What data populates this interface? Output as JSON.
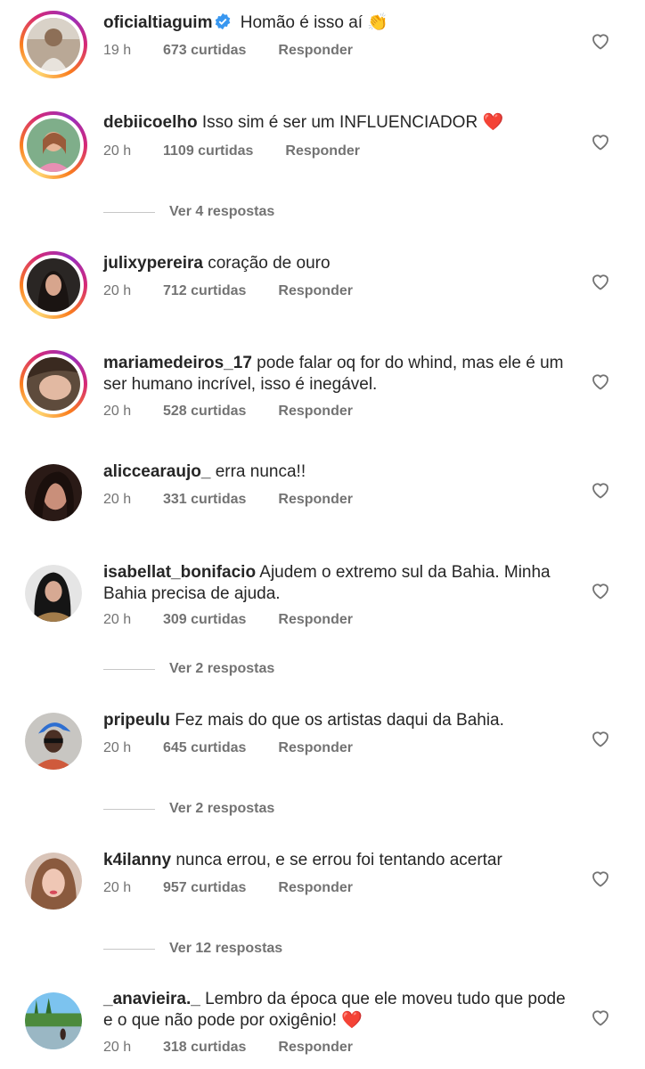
{
  "comments": [
    {
      "username": "oficialtiaguim",
      "verified": true,
      "text": "Homão é isso aí 👏",
      "time": "19 h",
      "likes": "673 curtidas",
      "reply": "Responder",
      "replies": ""
    },
    {
      "username": "debiicoelho",
      "verified": false,
      "text": "Isso sim é ser um INFLUENCIADOR ❤️",
      "time": "20 h",
      "likes": "1109 curtidas",
      "reply": "Responder",
      "replies": "Ver 4 respostas"
    },
    {
      "username": "julixypereira",
      "verified": false,
      "text": "coração de ouro",
      "time": "20 h",
      "likes": "712 curtidas",
      "reply": "Responder",
      "replies": ""
    },
    {
      "username": "mariamedeiros_17",
      "verified": false,
      "text": "pode falar oq for do whind, mas ele é um ser humano incrível, isso é inegável.",
      "time": "20 h",
      "likes": "528 curtidas",
      "reply": "Responder",
      "replies": ""
    },
    {
      "username": "aliccearaujo_",
      "verified": false,
      "text": "erra nunca!!",
      "time": "20 h",
      "likes": "331 curtidas",
      "reply": "Responder",
      "replies": ""
    },
    {
      "username": "isabellat_bonifacio",
      "verified": false,
      "text": "Ajudem o extremo sul da Bahia. Minha Bahia precisa de ajuda.",
      "time": "20 h",
      "likes": "309 curtidas",
      "reply": "Responder",
      "replies": "Ver 2 respostas"
    },
    {
      "username": "pripeulu",
      "verified": false,
      "text": "Fez mais do que os artistas daqui da Bahia.",
      "time": "20 h",
      "likes": "645 curtidas",
      "reply": "Responder",
      "replies": "Ver 2 respostas"
    },
    {
      "username": "k4ilanny",
      "verified": false,
      "text": "nunca errou, e se errou foi tentando acertar",
      "time": "20 h",
      "likes": "957 curtidas",
      "reply": "Responder",
      "replies": "Ver 12 respostas"
    },
    {
      "username": "_anavieira._",
      "verified": false,
      "text": "Lembro da época que ele moveu tudo que pode e o que não pode por oxigênio! ❤️",
      "time": "20 h",
      "likes": "318 curtidas",
      "reply": "Responder",
      "replies": ""
    }
  ],
  "icons": {
    "like": "heart-outline-icon",
    "verified": "verified-badge-icon"
  },
  "colors": {
    "verified": "#3897f0",
    "muted": "#737373",
    "text": "#262626"
  }
}
